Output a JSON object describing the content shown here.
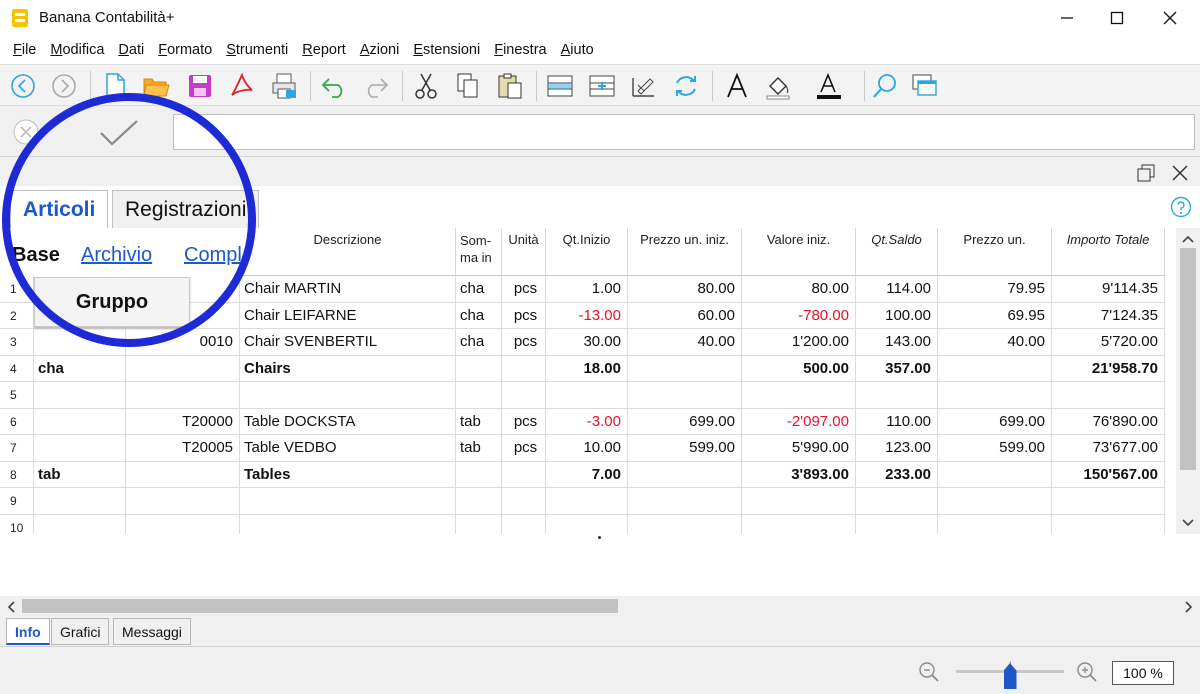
{
  "window": {
    "title": "Banana Contabilità+"
  },
  "menu": [
    "File",
    "Modifica",
    "Dati",
    "Formato",
    "Strumenti",
    "Report",
    "Azioni",
    "Estensioni",
    "Finestra",
    "Aiuto"
  ],
  "tabs": {
    "main": [
      "Articoli",
      "Registrazioni"
    ],
    "views": [
      "Base",
      "Archivio",
      "Compl"
    ]
  },
  "columns": {
    "gruppo": "Gruppo",
    "descrizione": "Descrizione",
    "somma_in": "Som-ma in",
    "unita": "Unità",
    "qt_inizio": "Qt.Inizio",
    "prezzo_un_iniz": "Prezzo un. iniz.",
    "valore_iniz": "Valore iniz.",
    "qt_saldo": "Qt.Saldo",
    "prezzo_un": "Prezzo un.",
    "importo_totale": "Importo Totale"
  },
  "rows": [
    {
      "n": "1",
      "gruppo": "",
      "id": "",
      "descr": "Chair MARTIN",
      "somma": "cha",
      "unita": "pcs",
      "qt_inizio": "1.00",
      "prezzo_iniz": "80.00",
      "valore_iniz": "80.00",
      "qt_saldo": "114.00",
      "prezzo_un": "79.95",
      "importo": "9'114.35"
    },
    {
      "n": "2",
      "gruppo": "",
      "id": "",
      "descr": "Chair LEIFARNE",
      "somma": "cha",
      "unita": "pcs",
      "qt_inizio": "-13.00",
      "prezzo_iniz": "60.00",
      "valore_iniz": "-780.00",
      "qt_saldo": "100.00",
      "prezzo_un": "69.95",
      "importo": "7'124.35"
    },
    {
      "n": "3",
      "gruppo": "",
      "id": "0010",
      "descr": "Chair SVENBERTIL",
      "somma": "cha",
      "unita": "pcs",
      "qt_inizio": "30.00",
      "prezzo_iniz": "40.00",
      "valore_iniz": "1'200.00",
      "qt_saldo": "143.00",
      "prezzo_un": "40.00",
      "importo": "5'720.00"
    },
    {
      "n": "4",
      "gruppo": "cha",
      "id": "",
      "descr": "Chairs",
      "somma": "",
      "unita": "",
      "qt_inizio": "18.00",
      "prezzo_iniz": "",
      "valore_iniz": "500.00",
      "qt_saldo": "357.00",
      "prezzo_un": "",
      "importo": "21'958.70"
    },
    {
      "n": "5",
      "gruppo": "",
      "id": "",
      "descr": "",
      "somma": "",
      "unita": "",
      "qt_inizio": "",
      "prezzo_iniz": "",
      "valore_iniz": "",
      "qt_saldo": "",
      "prezzo_un": "",
      "importo": ""
    },
    {
      "n": "6",
      "gruppo": "",
      "id": "T20000",
      "descr": "Table DOCKSTA",
      "somma": "tab",
      "unita": "pcs",
      "qt_inizio": "-3.00",
      "prezzo_iniz": "699.00",
      "valore_iniz": "-2'097.00",
      "qt_saldo": "110.00",
      "prezzo_un": "699.00",
      "importo": "76'890.00"
    },
    {
      "n": "7",
      "gruppo": "",
      "id": "T20005",
      "descr": "Table VEDBO",
      "somma": "tab",
      "unita": "pcs",
      "qt_inizio": "10.00",
      "prezzo_iniz": "599.00",
      "valore_iniz": "5'990.00",
      "qt_saldo": "123.00",
      "prezzo_un": "599.00",
      "importo": "73'677.00"
    },
    {
      "n": "8",
      "gruppo": "tab",
      "id": "",
      "descr": "Tables",
      "somma": "",
      "unita": "",
      "qt_inizio": "7.00",
      "prezzo_iniz": "",
      "valore_iniz": "3'893.00",
      "qt_saldo": "233.00",
      "prezzo_un": "",
      "importo": "150'567.00"
    },
    {
      "n": "9",
      "gruppo": "",
      "id": "",
      "descr": "",
      "somma": "",
      "unita": "",
      "qt_inizio": "",
      "prezzo_iniz": "",
      "valore_iniz": "",
      "qt_saldo": "",
      "prezzo_un": "",
      "importo": ""
    },
    {
      "n": "10",
      "gruppo": "",
      "id": "",
      "descr": "",
      "somma": "",
      "unita": "",
      "qt_inizio": "",
      "prezzo_iniz": "",
      "valore_iniz": "",
      "qt_saldo": "",
      "prezzo_un": "",
      "importo": ""
    }
  ],
  "bottom_tabs": [
    "Info",
    "Grafici",
    "Messaggi"
  ],
  "zoom": {
    "label": "100 %",
    "level": 0.5
  },
  "colors": {
    "accent": "#1e57c8",
    "circle": "#1d2ad6",
    "negative": "#e8102d"
  },
  "icons": [
    "back-icon",
    "forward-icon",
    "new-file-icon",
    "open-folder-icon",
    "save-icon",
    "pdf-icon",
    "print-icon",
    "undo-icon",
    "redo-icon",
    "cut-icon",
    "copy-icon",
    "paste-icon",
    "insert-row-icon",
    "add-rows-icon",
    "edit-row-icon",
    "refresh-icon",
    "font-icon",
    "fill-color-icon",
    "text-color-icon",
    "search-icon",
    "windows-icon"
  ]
}
